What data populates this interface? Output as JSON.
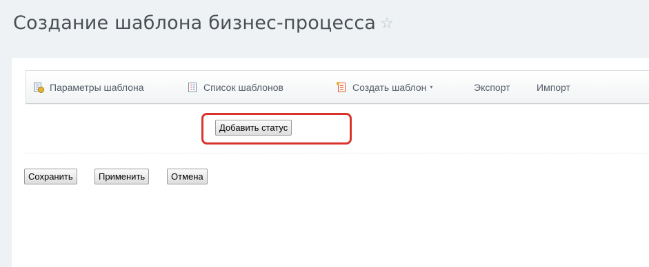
{
  "page": {
    "title": "Создание шаблона бизнес-процесса",
    "star_glyph": "☆"
  },
  "toolbar": {
    "items": [
      {
        "label": "Параметры шаблона",
        "icon": "template-params-icon"
      },
      {
        "label": "Список шаблонов",
        "icon": "template-list-icon"
      },
      {
        "label": "Создать шаблон",
        "icon": "create-template-icon",
        "dropdown_glyph": "▾"
      },
      {
        "label": "Экспорт"
      },
      {
        "label": "Импорт"
      }
    ]
  },
  "editor": {
    "add_status_label": "Добавить статус",
    "highlight_color": "#d9342b"
  },
  "form_buttons": {
    "save_label": "Сохранить",
    "apply_label": "Применить",
    "cancel_label": "Отмена"
  }
}
